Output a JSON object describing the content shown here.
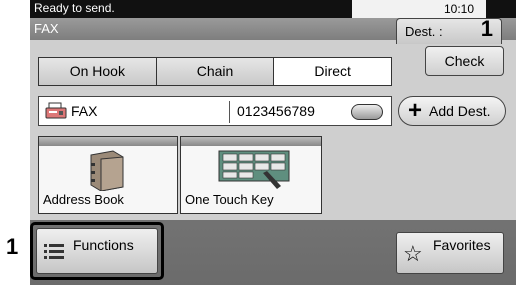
{
  "status": {
    "message": "Ready to send.",
    "time": "10:10"
  },
  "title": "FAX",
  "dest": {
    "label": "Dest. :",
    "count": "1"
  },
  "tabs": [
    {
      "label": "On Hook"
    },
    {
      "label": "Chain"
    },
    {
      "label": "Direct"
    }
  ],
  "check_label": "Check",
  "fax_entry": {
    "label": "FAX",
    "number": "0123456789"
  },
  "add_dest_label": "Add Dest.",
  "tiles": [
    {
      "label": "Address Book"
    },
    {
      "label": "One Touch Key"
    }
  ],
  "functions_label": "Functions",
  "favorites_label": "Favorites",
  "callout_number": "1",
  "icons": [
    "fax-icon",
    "more-icon",
    "plus-icon",
    "address-book-icon",
    "one-touch-key-icon",
    "list-icon",
    "star-icon"
  ]
}
